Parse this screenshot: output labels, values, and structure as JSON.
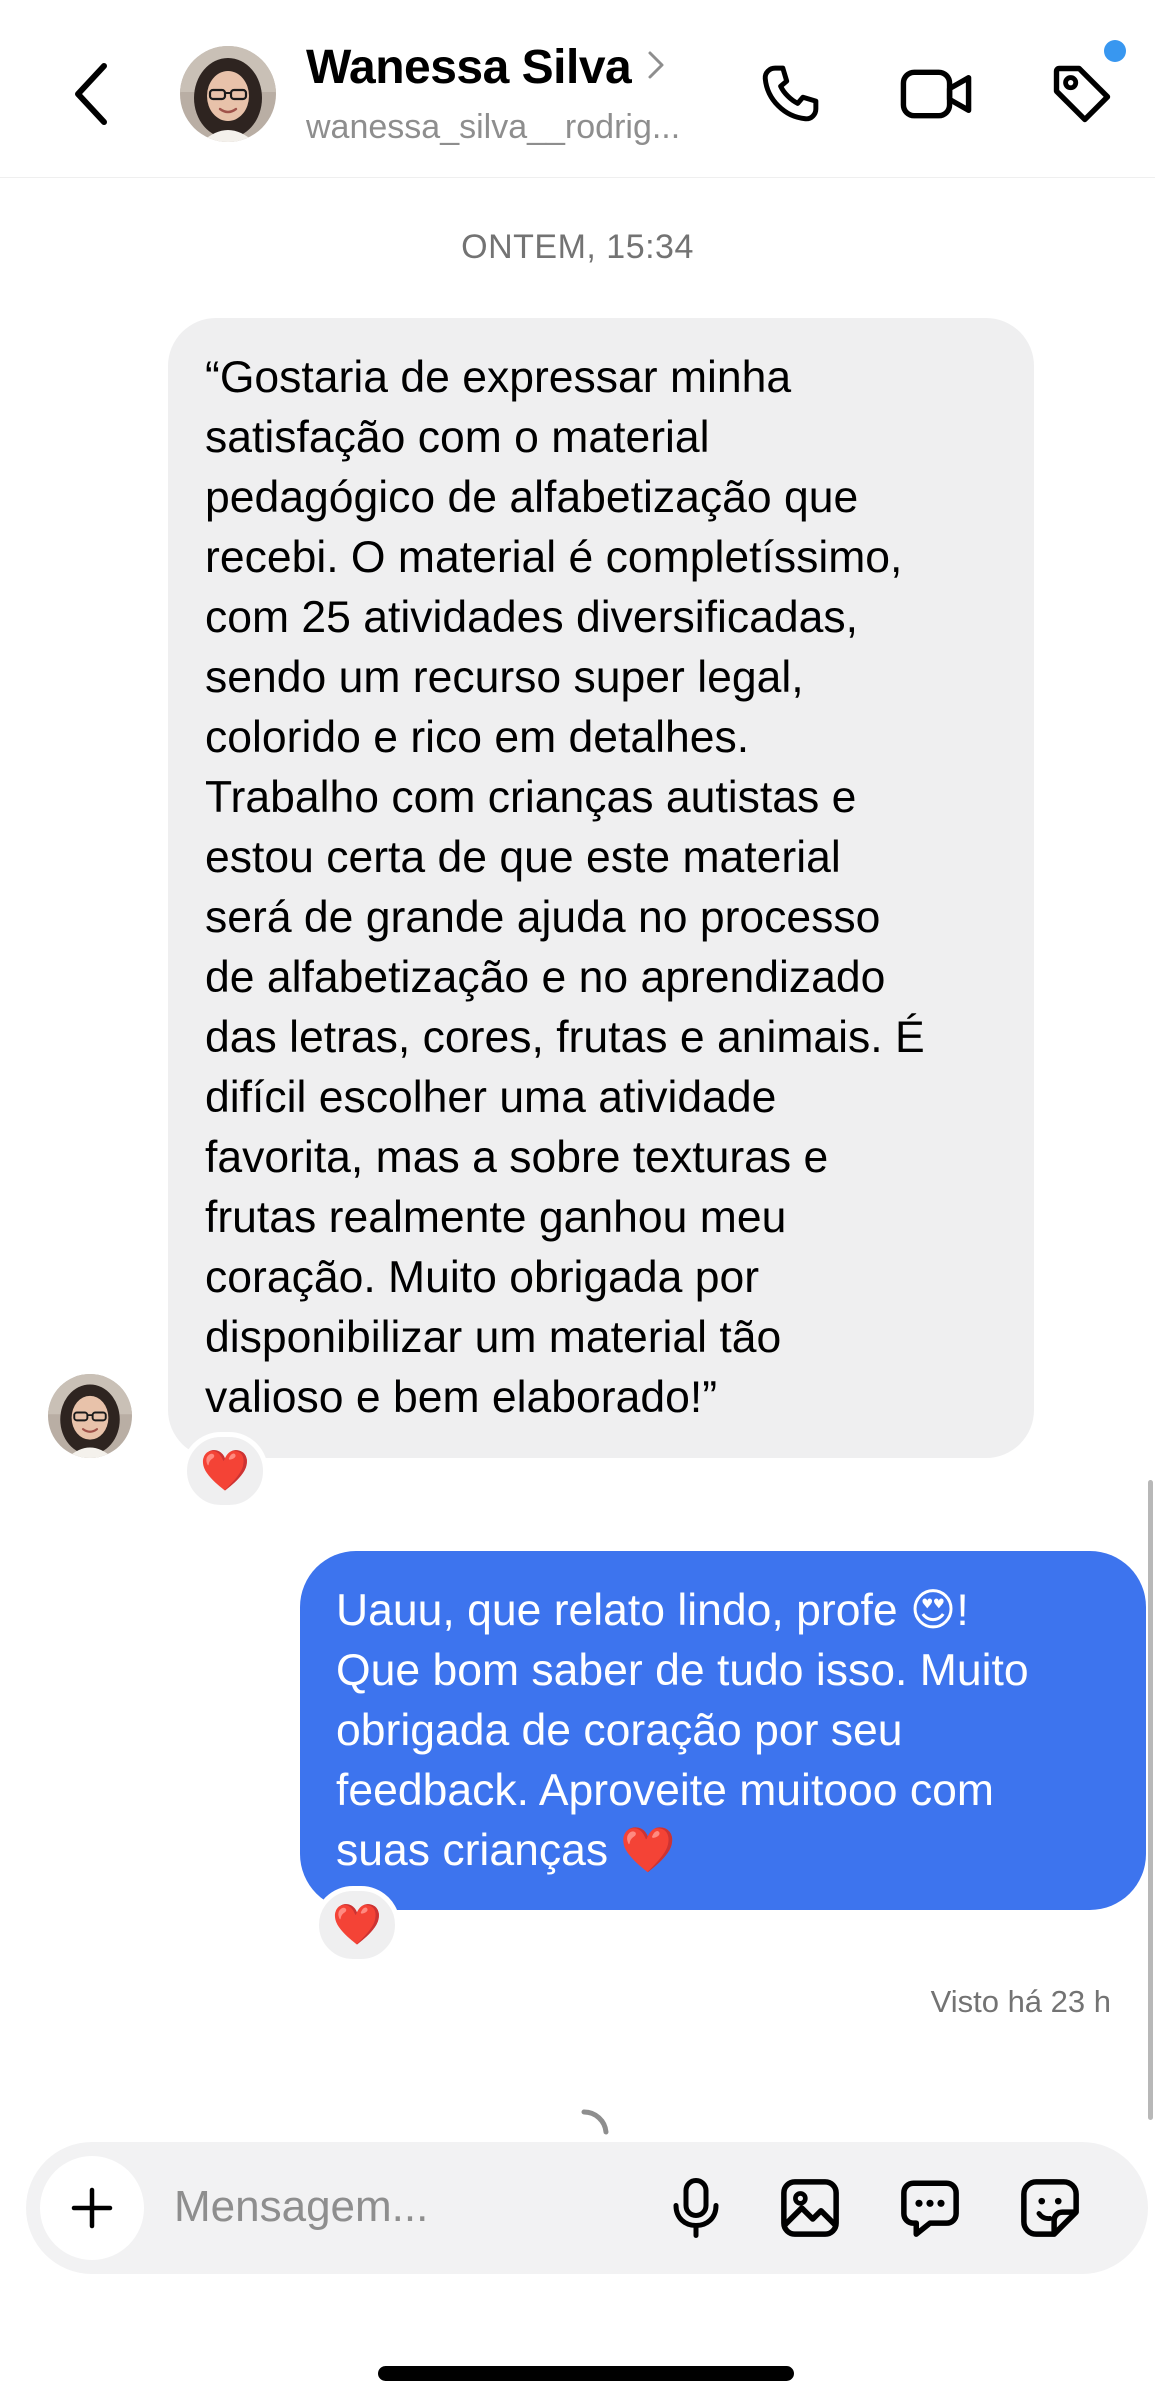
{
  "header": {
    "name": "Wanessa Silva",
    "username": "wanessa_silva__rodrig...",
    "icons": [
      "back-icon",
      "chevron-right-icon",
      "phone-icon",
      "video-camera-icon",
      "tag-icon"
    ]
  },
  "chat": {
    "timestamp": "ONTEM, 15:34",
    "received_message": "“Gostaria de expressar minha\nsatisfação com o material\npedagógico de alfabetização que\nrecebi. O material é completíssimo,\ncom 25 atividades diversificadas,\nsendo um recurso super legal,\ncolorido e rico em detalhes.\nTrabalho com crianças autistas e\nestou certa de que este material\nserá de grande ajuda no processo\nde alfabetização e no aprendizado\ndas letras, cores, frutas e animais. É\ndifícil escolher uma atividade\nfavorita, mas a sobre texturas e\nfrutas realmente ganhou meu\ncoração. Muito obrigada por\ndisponibilizar um material tão\nvalioso e bem elaborado!”",
    "received_reaction": "❤️",
    "sent_message": "Uauu, que relato lindo, profe 😍!\nQue bom saber de tudo isso. Muito\nobrigada de coração por seu\nfeedback. Aproveite muitooo com\nsuas crianças ❤️",
    "sent_reaction": "❤️",
    "seen_status": "Visto há 23 h"
  },
  "composer": {
    "placeholder": "Mensagem...",
    "icons": [
      "plus-icon",
      "microphone-icon",
      "gallery-icon",
      "chat-bubble-icon",
      "sticker-icon"
    ]
  },
  "colors": {
    "sent_bubble": "#3d74ee",
    "received_bubble": "#efeff0",
    "notification_dot": "#3897f0",
    "secondary_text": "#8e8e8e"
  }
}
